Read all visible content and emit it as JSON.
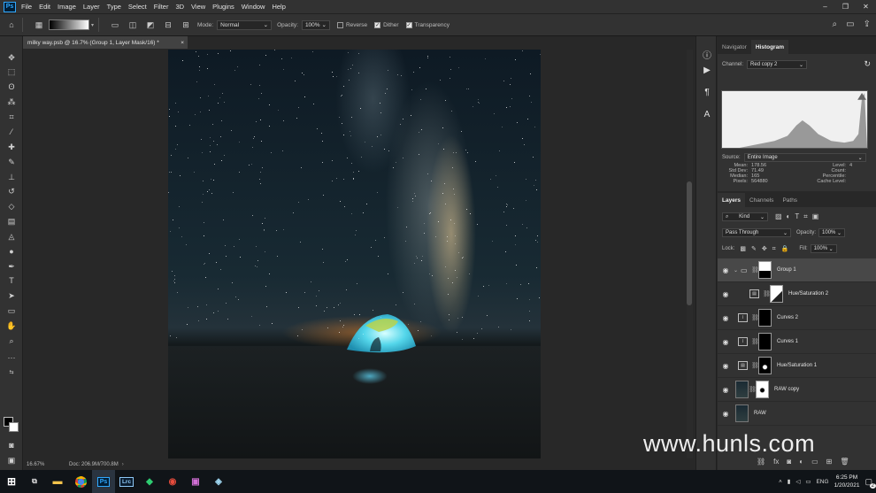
{
  "menubar": {
    "app_logo": "Ps",
    "items": [
      "File",
      "Edit",
      "Image",
      "Layer",
      "Type",
      "Select",
      "Filter",
      "3D",
      "View",
      "Plugins",
      "Window",
      "Help"
    ]
  },
  "options_bar": {
    "mode_label": "Mode:",
    "mode_value": "Normal",
    "opacity_label": "Opacity:",
    "opacity_value": "100%",
    "reverse_label": "Reverse",
    "dither_label": "Dither",
    "transparency_label": "Transparency"
  },
  "document": {
    "tab_title": "milky way.psb @ 16.7% (Group 1, Layer Mask/16) *",
    "close_glyph": "×"
  },
  "status": {
    "zoom": "16.67%",
    "doc_size": "Doc: 206.9M/700.8M"
  },
  "histogram_panel": {
    "tabs": [
      "Navigator",
      "Histogram"
    ],
    "channel_label": "Channel:",
    "channel_value": "Red copy 2",
    "source_label": "Source:",
    "source_value": "Entire Image",
    "stats_left_labels": [
      "Mean:",
      "Std Dev:",
      "Median:",
      "Pixels:"
    ],
    "stats_left_values": [
      "178.56",
      "71.49",
      "165",
      "564880"
    ],
    "stats_right_labels": [
      "Level:",
      "Count:",
      "Percentile:",
      "Cache Level:"
    ],
    "stats_right_values": [
      "",
      "",
      "",
      "4"
    ]
  },
  "layers_panel": {
    "tabs": [
      "Layers",
      "Channels",
      "Paths"
    ],
    "kind_label": "Kind",
    "blend_mode": "Pass Through",
    "opacity_label": "Opacity:",
    "opacity_value": "100%",
    "lock_label": "Lock:",
    "fill_label": "Fill:",
    "fill_value": "100%",
    "layers": [
      {
        "name": "Group 1"
      },
      {
        "name": "Hue/Saturation 2"
      },
      {
        "name": "Curves 2"
      },
      {
        "name": "Curves 1"
      },
      {
        "name": "Hue/Saturation 1"
      },
      {
        "name": "RAW copy"
      },
      {
        "name": "RAW"
      }
    ]
  },
  "taskbar": {
    "language": "ENG",
    "time": "6:25 PM",
    "date": "1/20/2021",
    "notifications": "2",
    "lrc_label": "Lrc",
    "ps_label": "Ps"
  },
  "watermark": "www.hunls.com"
}
